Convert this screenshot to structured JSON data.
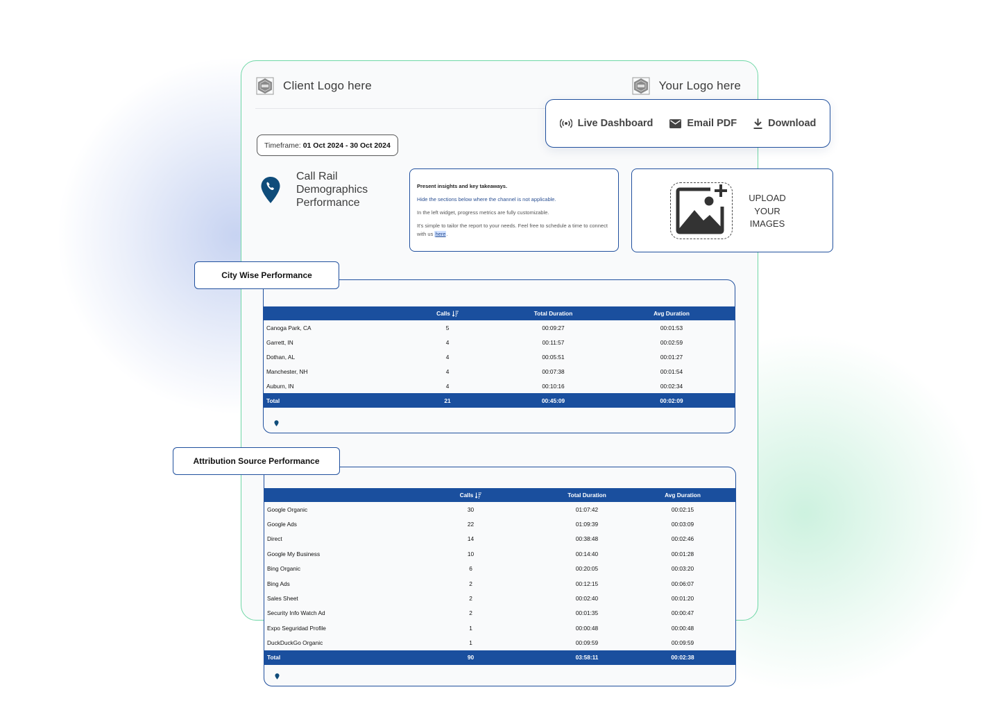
{
  "header": {
    "client_logo_text": "Client Logo here",
    "your_logo_text": "Your Logo here"
  },
  "actions": [
    {
      "label": "Live Dashboard",
      "icon": "broadcast-icon"
    },
    {
      "label": "Email PDF",
      "icon": "envelope-icon"
    },
    {
      "label": "Download",
      "icon": "download-icon"
    }
  ],
  "timeframe": {
    "label": "Timeframe:",
    "value": "01 Oct 2024 - 30 Oct 2024"
  },
  "report": {
    "title_lines": [
      "Call Rail",
      "Demographics",
      "Performance"
    ],
    "icon": "phone-pin-icon"
  },
  "insights": {
    "line1": "Present insights and key takeaways.",
    "line2": "Hide the sections below where the channel is not applicable.",
    "line3": "In the left widget, progress metrics are fully customizable.",
    "line4_prefix": "It's simple to tailor the report to your needs. Feel free to schedule a time to connect with us ",
    "line4_link": "here",
    "line4_suffix": "."
  },
  "upload": {
    "lines": [
      "UPLOAD",
      "YOUR",
      "IMAGES"
    ],
    "icon": "add-image-icon"
  },
  "colors": {
    "brand_blue": "#1a4f9e",
    "card_green_border": "#6fd7a6",
    "background": "#ffffff"
  },
  "city_table": {
    "section_title": "City Wise Performance",
    "columns": [
      "",
      "Calls",
      "Total Duration",
      "Avg Duration"
    ],
    "rows": [
      [
        "Canoga Park, CA",
        "5",
        "00:09:27",
        "00:01:53"
      ],
      [
        "Garrett, IN",
        "4",
        "00:11:57",
        "00:02:59"
      ],
      [
        "Dothan, AL",
        "4",
        "00:05:51",
        "00:01:27"
      ],
      [
        "Manchester, NH",
        "4",
        "00:07:38",
        "00:01:54"
      ],
      [
        "Auburn, IN",
        "4",
        "00:10:16",
        "00:02:34"
      ]
    ],
    "total": [
      "Total",
      "21",
      "00:45:09",
      "00:02:09"
    ]
  },
  "source_table": {
    "section_title": "Attribution Source Performance",
    "columns": [
      "",
      "Calls",
      "Total Duration",
      "Avg Duration"
    ],
    "rows": [
      [
        "Google Organic",
        "30",
        "01:07:42",
        "00:02:15"
      ],
      [
        "Google Ads",
        "22",
        "01:09:39",
        "00:03:09"
      ],
      [
        "Direct",
        "14",
        "00:38:48",
        "00:02:46"
      ],
      [
        "Google My Business",
        "10",
        "00:14:40",
        "00:01:28"
      ],
      [
        "Bing Organic",
        "6",
        "00:20:05",
        "00:03:20"
      ],
      [
        "Bing Ads",
        "2",
        "00:12:15",
        "00:06:07"
      ],
      [
        "Sales Sheet",
        "2",
        "00:02:40",
        "00:01:20"
      ],
      [
        "Security Info Watch Ad",
        "2",
        "00:01:35",
        "00:00:47"
      ],
      [
        "Expo Seguridad Profile",
        "1",
        "00:00:48",
        "00:00:48"
      ],
      [
        "DuckDuckGo Organic",
        "1",
        "00:09:59",
        "00:09:59"
      ]
    ],
    "total": [
      "Total",
      "90",
      "03:58:11",
      "00:02:38"
    ]
  }
}
